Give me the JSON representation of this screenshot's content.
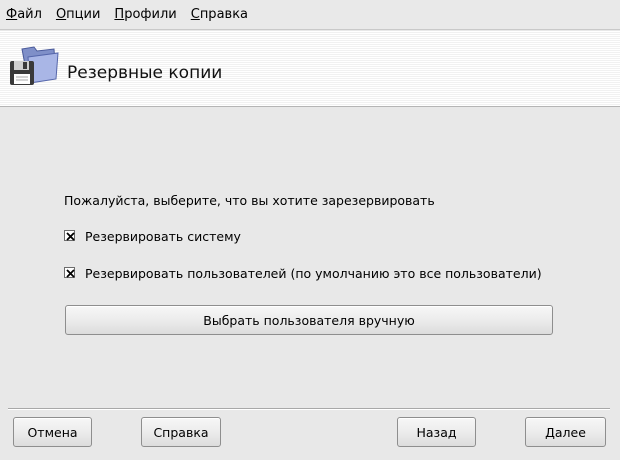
{
  "menu": {
    "items": [
      {
        "accel": "Ф",
        "rest": "айл"
      },
      {
        "accel": "О",
        "rest": "пции"
      },
      {
        "accel": "П",
        "rest": "рофили"
      },
      {
        "accel": "С",
        "rest": "правка"
      }
    ]
  },
  "banner": {
    "title": "Резервные копии",
    "icon": "backup-folder-floppy-icon"
  },
  "content": {
    "prompt": "Пожалуйста, выберите, что вы хотите зарезервировать",
    "options": [
      {
        "label": "Резервировать систему",
        "checked": true
      },
      {
        "label": "Резервировать пользователей (по умолчанию это все пользователи)",
        "checked": true
      }
    ],
    "choose_users_button": "Выбрать пользователя вручную"
  },
  "footer": {
    "cancel": "Отмена",
    "help": "Справка",
    "back": "Назад",
    "next": "Далее"
  }
}
